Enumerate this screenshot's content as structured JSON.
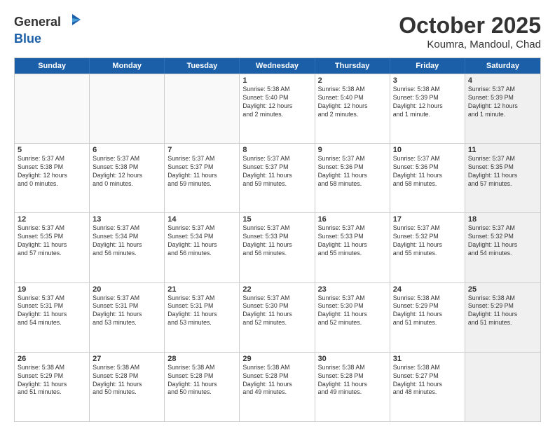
{
  "header": {
    "logo_general": "General",
    "logo_blue": "Blue",
    "month": "October 2025",
    "location": "Koumra, Mandoul, Chad"
  },
  "weekdays": [
    "Sunday",
    "Monday",
    "Tuesday",
    "Wednesday",
    "Thursday",
    "Friday",
    "Saturday"
  ],
  "rows": [
    [
      {
        "day": "",
        "text": "",
        "empty": true
      },
      {
        "day": "",
        "text": "",
        "empty": true
      },
      {
        "day": "",
        "text": "",
        "empty": true
      },
      {
        "day": "1",
        "text": "Sunrise: 5:38 AM\nSunset: 5:40 PM\nDaylight: 12 hours\nand 2 minutes."
      },
      {
        "day": "2",
        "text": "Sunrise: 5:38 AM\nSunset: 5:40 PM\nDaylight: 12 hours\nand 2 minutes."
      },
      {
        "day": "3",
        "text": "Sunrise: 5:38 AM\nSunset: 5:39 PM\nDaylight: 12 hours\nand 1 minute."
      },
      {
        "day": "4",
        "text": "Sunrise: 5:37 AM\nSunset: 5:39 PM\nDaylight: 12 hours\nand 1 minute.",
        "shaded": true
      }
    ],
    [
      {
        "day": "5",
        "text": "Sunrise: 5:37 AM\nSunset: 5:38 PM\nDaylight: 12 hours\nand 0 minutes."
      },
      {
        "day": "6",
        "text": "Sunrise: 5:37 AM\nSunset: 5:38 PM\nDaylight: 12 hours\nand 0 minutes."
      },
      {
        "day": "7",
        "text": "Sunrise: 5:37 AM\nSunset: 5:37 PM\nDaylight: 11 hours\nand 59 minutes."
      },
      {
        "day": "8",
        "text": "Sunrise: 5:37 AM\nSunset: 5:37 PM\nDaylight: 11 hours\nand 59 minutes."
      },
      {
        "day": "9",
        "text": "Sunrise: 5:37 AM\nSunset: 5:36 PM\nDaylight: 11 hours\nand 58 minutes."
      },
      {
        "day": "10",
        "text": "Sunrise: 5:37 AM\nSunset: 5:36 PM\nDaylight: 11 hours\nand 58 minutes."
      },
      {
        "day": "11",
        "text": "Sunrise: 5:37 AM\nSunset: 5:35 PM\nDaylight: 11 hours\nand 57 minutes.",
        "shaded": true
      }
    ],
    [
      {
        "day": "12",
        "text": "Sunrise: 5:37 AM\nSunset: 5:35 PM\nDaylight: 11 hours\nand 57 minutes."
      },
      {
        "day": "13",
        "text": "Sunrise: 5:37 AM\nSunset: 5:34 PM\nDaylight: 11 hours\nand 56 minutes."
      },
      {
        "day": "14",
        "text": "Sunrise: 5:37 AM\nSunset: 5:34 PM\nDaylight: 11 hours\nand 56 minutes."
      },
      {
        "day": "15",
        "text": "Sunrise: 5:37 AM\nSunset: 5:33 PM\nDaylight: 11 hours\nand 56 minutes."
      },
      {
        "day": "16",
        "text": "Sunrise: 5:37 AM\nSunset: 5:33 PM\nDaylight: 11 hours\nand 55 minutes."
      },
      {
        "day": "17",
        "text": "Sunrise: 5:37 AM\nSunset: 5:32 PM\nDaylight: 11 hours\nand 55 minutes."
      },
      {
        "day": "18",
        "text": "Sunrise: 5:37 AM\nSunset: 5:32 PM\nDaylight: 11 hours\nand 54 minutes.",
        "shaded": true
      }
    ],
    [
      {
        "day": "19",
        "text": "Sunrise: 5:37 AM\nSunset: 5:31 PM\nDaylight: 11 hours\nand 54 minutes."
      },
      {
        "day": "20",
        "text": "Sunrise: 5:37 AM\nSunset: 5:31 PM\nDaylight: 11 hours\nand 53 minutes."
      },
      {
        "day": "21",
        "text": "Sunrise: 5:37 AM\nSunset: 5:31 PM\nDaylight: 11 hours\nand 53 minutes."
      },
      {
        "day": "22",
        "text": "Sunrise: 5:37 AM\nSunset: 5:30 PM\nDaylight: 11 hours\nand 52 minutes."
      },
      {
        "day": "23",
        "text": "Sunrise: 5:37 AM\nSunset: 5:30 PM\nDaylight: 11 hours\nand 52 minutes."
      },
      {
        "day": "24",
        "text": "Sunrise: 5:38 AM\nSunset: 5:29 PM\nDaylight: 11 hours\nand 51 minutes."
      },
      {
        "day": "25",
        "text": "Sunrise: 5:38 AM\nSunset: 5:29 PM\nDaylight: 11 hours\nand 51 minutes.",
        "shaded": true
      }
    ],
    [
      {
        "day": "26",
        "text": "Sunrise: 5:38 AM\nSunset: 5:29 PM\nDaylight: 11 hours\nand 51 minutes."
      },
      {
        "day": "27",
        "text": "Sunrise: 5:38 AM\nSunset: 5:28 PM\nDaylight: 11 hours\nand 50 minutes."
      },
      {
        "day": "28",
        "text": "Sunrise: 5:38 AM\nSunset: 5:28 PM\nDaylight: 11 hours\nand 50 minutes."
      },
      {
        "day": "29",
        "text": "Sunrise: 5:38 AM\nSunset: 5:28 PM\nDaylight: 11 hours\nand 49 minutes."
      },
      {
        "day": "30",
        "text": "Sunrise: 5:38 AM\nSunset: 5:28 PM\nDaylight: 11 hours\nand 49 minutes."
      },
      {
        "day": "31",
        "text": "Sunrise: 5:38 AM\nSunset: 5:27 PM\nDaylight: 11 hours\nand 48 minutes."
      },
      {
        "day": "",
        "text": "",
        "empty": true,
        "shaded": true
      }
    ]
  ]
}
